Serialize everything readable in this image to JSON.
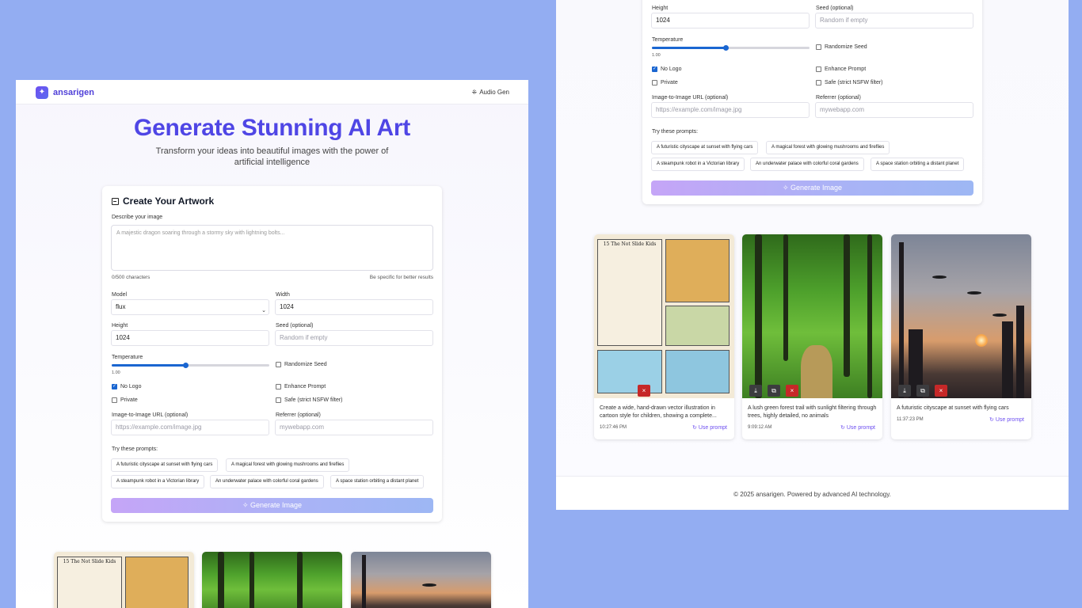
{
  "app": {
    "name": "ansarigen",
    "nav_link": "Audio Gen"
  },
  "hero": {
    "title": "Generate Stunning AI Art",
    "subtitle": "Transform your ideas into beautiful images with the power of artificial intelligence"
  },
  "form": {
    "title": "Create Your Artwork",
    "describe_label": "Describe your image",
    "describe_placeholder": "A majestic dragon soaring through a stormy sky with lightning bolts...",
    "char_count": "0/500 characters",
    "hint": "Be specific for better results",
    "model_label": "Model",
    "model_value": "flux",
    "width_label": "Width",
    "width_value": "1024",
    "height_label": "Height",
    "height_value": "1024",
    "seed_label": "Seed (optional)",
    "seed_placeholder": "Random if empty",
    "temperature_label": "Temperature",
    "temperature_value": "1.00",
    "temperature_fraction": 0.47,
    "randomize_seed": "Randomize Seed",
    "no_logo": "No Logo",
    "enhance_prompt": "Enhance Prompt",
    "private": "Private",
    "safe": "Safe (strict NSFW filter)",
    "img2img_label": "Image-to-Image URL (optional)",
    "img2img_placeholder": "https://example.com/image.jpg",
    "referrer_label": "Referrer (optional)",
    "referrer_placeholder": "mywebapp.com",
    "try_label": "Try these prompts:",
    "prompts": [
      "A futuristic cityscape at sunset with flying cars",
      "A magical forest with glowing mushrooms and fireflies",
      "A steampunk robot in a Victorian library",
      "An underwater palace with colorful coral gardens",
      "A space station orbiting a distant planet"
    ],
    "generate_label": "Generate Image"
  },
  "gallery": [
    {
      "caption": "Create a wide, hand-drawn vector illustration in cartoon style for children, showing a complete...",
      "time": "10:27:46 PM",
      "use": "Use prompt",
      "comic_title": "15 The Not Slide Kids"
    },
    {
      "caption": "A lush green forest trail with sunlight filtering through trees, highly detailed, no animals",
      "time": "9:09:12 AM",
      "use": "Use prompt"
    },
    {
      "caption": "A futuristic cityscape at sunset with flying cars",
      "time": "11:37:23 PM",
      "use": "Use prompt"
    }
  ],
  "footer": {
    "text": "© 2025 ansarigen. Powered by advanced AI technology."
  },
  "colors": {
    "accent": "#4f46e5",
    "background": "#93adf2",
    "check": "#1a66d1",
    "delete": "#c62828"
  },
  "icons": {
    "logo": "sparkle-icon",
    "audio": "audio-wave-icon",
    "generate": "sparkle-icon",
    "download": "download-icon",
    "copy": "copy-icon",
    "delete": "close-icon",
    "refresh": "refresh-icon"
  }
}
